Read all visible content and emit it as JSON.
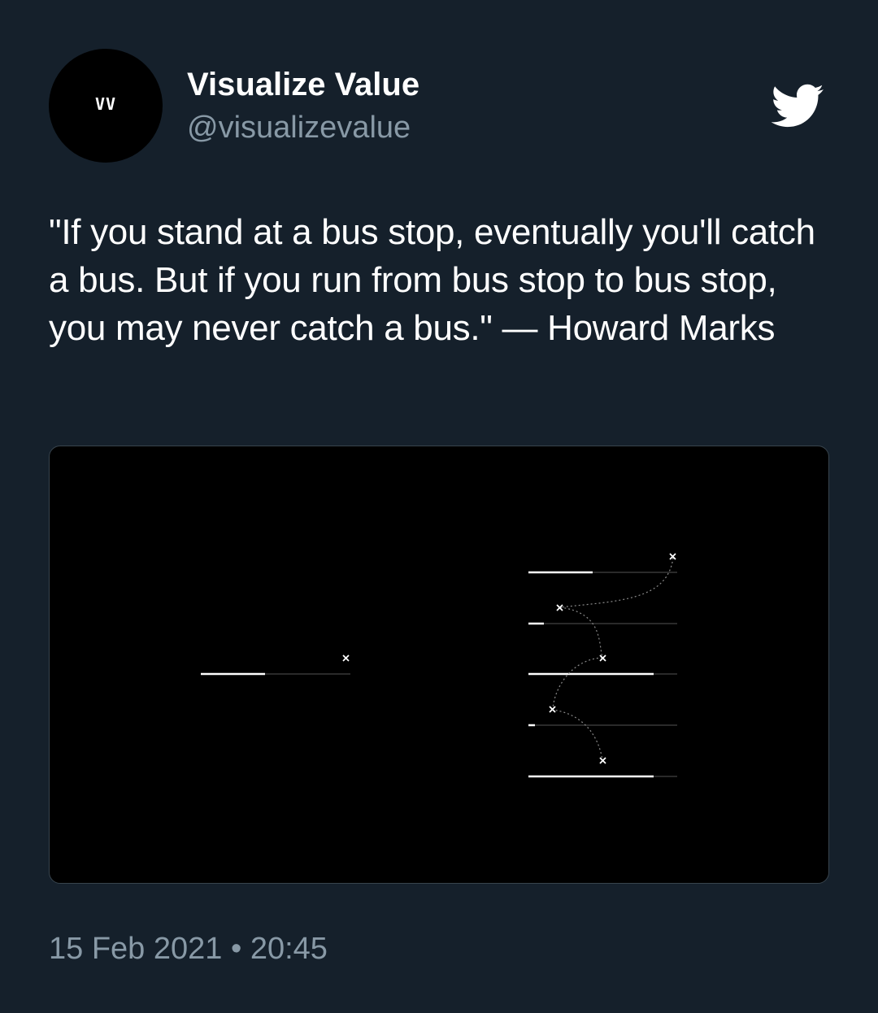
{
  "profile": {
    "display_name": "Visualize Value",
    "handle": "@visualizevalue",
    "avatar_mark": "VV"
  },
  "tweet": {
    "text": "\"If you stand at a bus stop, eventually you'll catch a bus. But if you run from bus stop to bus stop, you may never catch a bus.\" — Howard Marks",
    "timestamp": "15 Feb 2021 • 20:45"
  },
  "icons": {
    "brand": "twitter-bird-icon"
  },
  "colors": {
    "background": "#15202b",
    "text_primary": "#ffffff",
    "text_secondary": "#8899a6",
    "media_background": "#000000",
    "brand": "#ffffff"
  }
}
